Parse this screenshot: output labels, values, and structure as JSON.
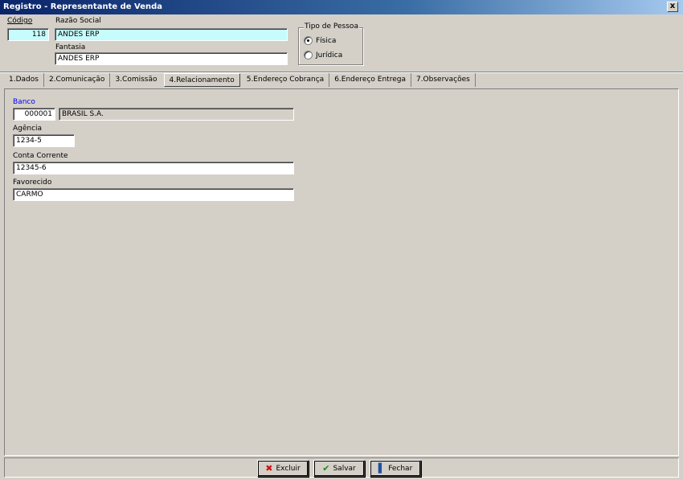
{
  "window": {
    "title": "Registro - Representante de Venda",
    "close_label": "x"
  },
  "header": {
    "codigo_label": "Código",
    "codigo_value": "118",
    "razao_label": "Razão Social",
    "razao_value": "ANDES ERP",
    "fantasia_label": "Fantasia",
    "fantasia_value": "ANDES ERP",
    "tipo_pessoa": {
      "title": "Tipo de Pessoa",
      "options": [
        "Física",
        "Jurídica"
      ],
      "selected": "Física"
    }
  },
  "tabs": [
    {
      "label": "1.Dados"
    },
    {
      "label": "2.Comunicação"
    },
    {
      "label": "3.Comissão"
    },
    {
      "label": "4.Relacionamento"
    },
    {
      "label": "5.Endereço Cobrança"
    },
    {
      "label": "6.Endereço Entrega"
    },
    {
      "label": "7.Observações"
    }
  ],
  "active_tab": "4.Relacionamento",
  "form": {
    "banco_label": "Banco",
    "banco_code": "000001",
    "banco_name": "BRASIL S.A.",
    "agencia_label": "Agência",
    "agencia_value": "1234-5",
    "conta_label": "Conta Corrente",
    "conta_value": "12345-6",
    "favorecido_label": "Favorecido",
    "favorecido_value": "CARMO"
  },
  "buttons": {
    "excluir": "Excluir",
    "salvar": "Salvar",
    "fechar": "Fechar"
  },
  "colors": {
    "required_field": "#c6fcfc",
    "link_label": "#0000ff",
    "title_bar": "#0a246a"
  }
}
